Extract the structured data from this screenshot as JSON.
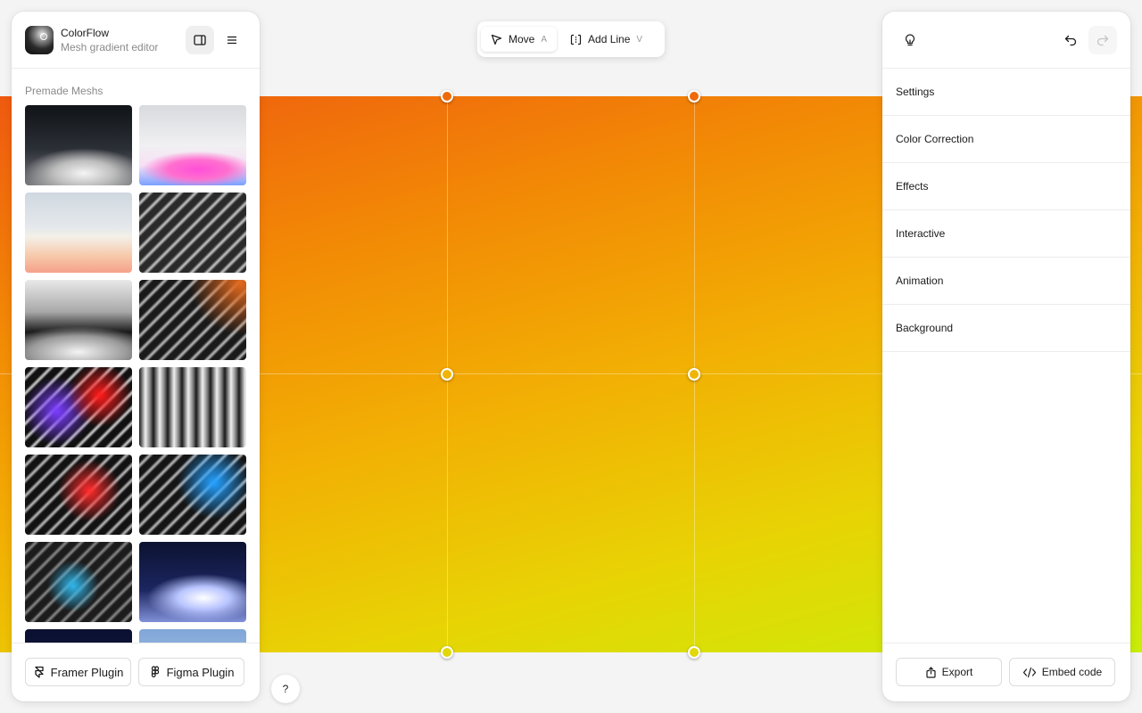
{
  "app": {
    "name": "ColorFlow",
    "subtitle": "Mesh gradient editor"
  },
  "left_panel": {
    "section_title": "Premade Meshs",
    "presets": [
      {
        "name": "mono-wave"
      },
      {
        "name": "pink-cloud"
      },
      {
        "name": "sunset-wave"
      },
      {
        "name": "grey-stripes"
      },
      {
        "name": "chrome-fold"
      },
      {
        "name": "orange-stripes"
      },
      {
        "name": "red-violet-stripes"
      },
      {
        "name": "mono-glass"
      },
      {
        "name": "red-stripes"
      },
      {
        "name": "blue-stripes"
      },
      {
        "name": "teal-stripes"
      },
      {
        "name": "navy-glow"
      },
      {
        "name": "navy-dark"
      },
      {
        "name": "sky-fade"
      }
    ],
    "framer_label": "Framer Plugin",
    "figma_label": "Figma Plugin"
  },
  "toolbar": {
    "move_label": "Move",
    "move_key": "A",
    "add_line_label": "Add Line",
    "add_line_key": "V"
  },
  "right_panel": {
    "sections": [
      "Settings",
      "Color Correction",
      "Effects",
      "Interactive",
      "Animation",
      "Background"
    ],
    "export_label": "Export",
    "embed_label": "Embed code"
  },
  "help_label": "?",
  "colors": {
    "gradient_top": "#ef5a10",
    "gradient_bottom": "#c9ee08",
    "handle_top": "#ee6a0a",
    "handle_mid": "#f0b503",
    "handle_bottom": "#e2d807"
  }
}
